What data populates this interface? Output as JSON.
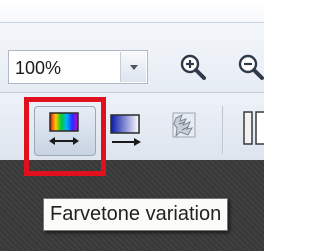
{
  "zoom": {
    "value": "100%"
  },
  "toolbar": {
    "zoom_in_icon": "zoom-in-icon",
    "zoom_out_icon": "zoom-out-icon",
    "farvetone_icon": "farvetone-variation-icon",
    "gradient_icon": "gradient-fill-icon",
    "pattern_icon": "pattern-icon"
  },
  "tooltip": {
    "text": "Farvetone variation"
  },
  "colors": {
    "selection_highlight": "#e0101c",
    "tooltip_background": "#fbfbf7",
    "canvas_background": "#3a3a3a"
  }
}
